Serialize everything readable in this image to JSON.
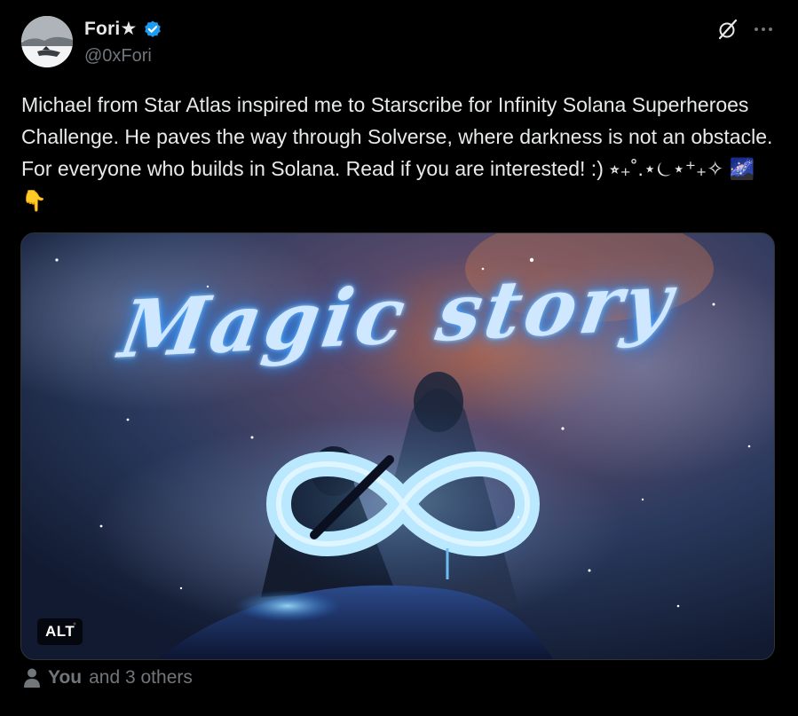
{
  "author": {
    "display_name": "Fori★",
    "handle": "@0xFori",
    "verified": true,
    "avatar_icon": "avatar-winter-landscape"
  },
  "actions": {
    "grok_icon": "grok-slash-icon",
    "more_icon": "more-dots-icon"
  },
  "post": {
    "text": "Michael from Star Atlas inspired me to Starscribe for Infinity Solana Superheroes Challenge. He paves the way through Solverse, where darkness is not an obstacle. For everyone who builds in Solana. Read if you are interested! :) ⭒₊˚.⋆⏾⋆⁺₊✧ 🌌👇"
  },
  "media": {
    "image_title": "Magic story",
    "alt_label": "ALT"
  },
  "likes": {
    "you": "You",
    "others": "and 3 others"
  },
  "colors": {
    "background": "#000000",
    "text_primary": "#e7e9ea",
    "text_secondary": "#71767b",
    "verified_blue": "#1d9bf0",
    "border": "#2f3336"
  }
}
